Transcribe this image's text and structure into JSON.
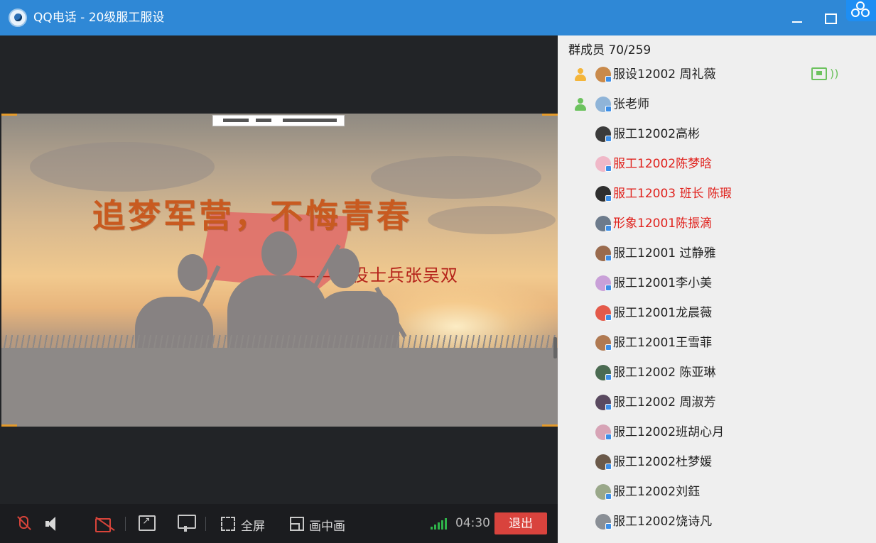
{
  "window": {
    "title": "QQ电话 - 20级服工服设"
  },
  "slide": {
    "title": "追梦军营，不悔青春",
    "subtitle": "——退役士兵张吴双"
  },
  "toolbar": {
    "fullscreen_label": "全屏",
    "pip_label": "画中画",
    "timer": "04:30",
    "exit_label": "退出"
  },
  "members": {
    "header": "群成员 70/259",
    "items": [
      {
        "name": "服设12002 周礼薇",
        "role": "owner",
        "highlight": false,
        "avatar_color": "#c98a4b"
      },
      {
        "name": "张老师",
        "role": "admin",
        "highlight": false,
        "avatar_color": "#8fb4d8"
      },
      {
        "name": "服工12002高彬",
        "role": "",
        "highlight": false,
        "avatar_color": "#3b3b3b"
      },
      {
        "name": "服工12002陈梦晗",
        "role": "",
        "highlight": true,
        "avatar_color": "#f0b8c8"
      },
      {
        "name": "服工12003 班长 陈瑕",
        "role": "",
        "highlight": true,
        "avatar_color": "#2e2e2e"
      },
      {
        "name": "形象12001陈振滴",
        "role": "",
        "highlight": true,
        "avatar_color": "#6d7b8c"
      },
      {
        "name": "服工12001 过静雅",
        "role": "",
        "highlight": false,
        "avatar_color": "#9a6b4e"
      },
      {
        "name": "服工12001李小美",
        "role": "",
        "highlight": false,
        "avatar_color": "#c9a0d8"
      },
      {
        "name": "服工12001龙晨薇",
        "role": "",
        "highlight": false,
        "avatar_color": "#e45a4a"
      },
      {
        "name": "服工12001王雪菲",
        "role": "",
        "highlight": false,
        "avatar_color": "#b07a52"
      },
      {
        "name": "服工12002 陈亚琳",
        "role": "",
        "highlight": false,
        "avatar_color": "#4b6b52"
      },
      {
        "name": "服工12002 周淑芳",
        "role": "",
        "highlight": false,
        "avatar_color": "#5a4a60"
      },
      {
        "name": "服工12002班胡心月",
        "role": "",
        "highlight": false,
        "avatar_color": "#d7a4b6"
      },
      {
        "name": "服工12002杜梦媛",
        "role": "",
        "highlight": false,
        "avatar_color": "#6b5a4a"
      },
      {
        "name": "服工12002刘鈺",
        "role": "",
        "highlight": false,
        "avatar_color": "#9aa88a"
      },
      {
        "name": "服工12002饶诗凡",
        "role": "",
        "highlight": false,
        "avatar_color": "#8a8f96"
      }
    ]
  },
  "colors": {
    "titlebar": "#2f88d6",
    "exit_button": "#d9433d",
    "highlight_text": "#e0211c",
    "signal": "#2fb44a"
  }
}
